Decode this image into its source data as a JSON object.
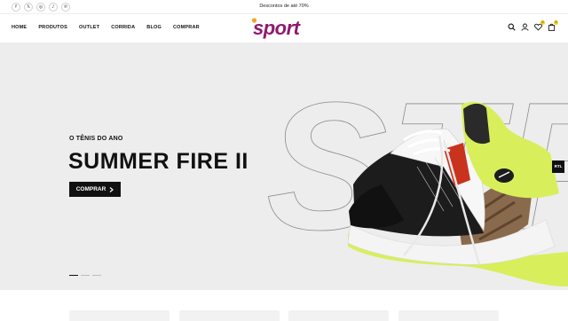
{
  "topbar": {
    "announcement": "Descontos de até 70%",
    "social": [
      {
        "icon": "facebook-icon",
        "glyph": "f"
      },
      {
        "icon": "x-icon",
        "glyph": "𝕏"
      },
      {
        "icon": "instagram-icon",
        "glyph": "◎"
      },
      {
        "icon": "tiktok-icon",
        "glyph": "♪"
      },
      {
        "icon": "pinterest-icon",
        "glyph": "℗"
      }
    ]
  },
  "nav": {
    "items": [
      "HOME",
      "PRODUTOS",
      "OUTLET",
      "CORRIDA",
      "BLOG",
      "COMPRAR"
    ]
  },
  "logo": {
    "text": "sport",
    "colors": {
      "primary": "#8e1a6f",
      "dot": "#f4a11d"
    }
  },
  "header_icons": {
    "search": "search-icon",
    "account": "user-icon",
    "wishlist": {
      "icon": "heart-icon",
      "count": "0"
    },
    "cart": {
      "icon": "cart-icon",
      "count": "0"
    }
  },
  "hero": {
    "subtitle": "O TÊNIS DO ANO",
    "title": "SUMMER FIRE II",
    "button_label": "COMPRAR",
    "button_icon": "chevron-right-icon",
    "background_word": "STR",
    "slides": 3,
    "active_slide": 1,
    "colors": {
      "background": "#ededed",
      "accent": "#d9ee5b"
    }
  },
  "rtl_toggle": "RTL",
  "accent_colors": {
    "dark": "#111111",
    "badge": "#f4d21f"
  }
}
